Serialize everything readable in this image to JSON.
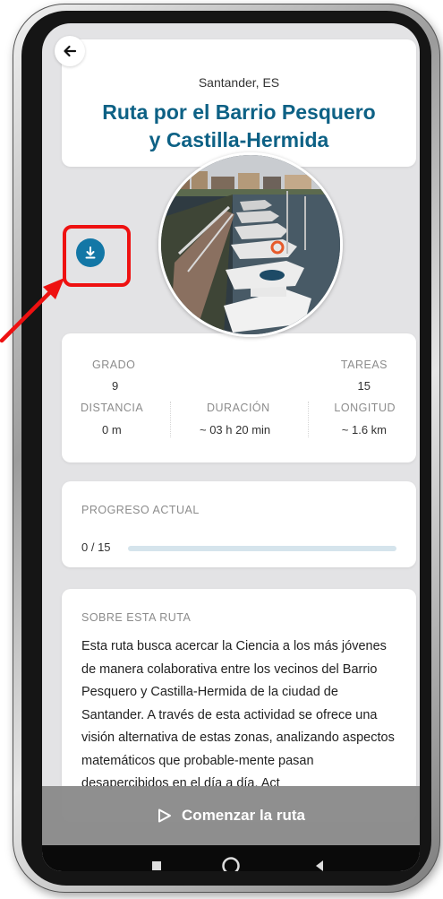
{
  "header": {
    "location": "Santander, ES",
    "title_line1": "Ruta por el Barrio Pesquero",
    "title_line2": "y Castilla-Hermida"
  },
  "stats": {
    "grado_label": "GRADO",
    "grado_value": "9",
    "tareas_label": "TAREAS",
    "tareas_value": "15",
    "distancia_label": "DISTANCIA",
    "distancia_value": "0 m",
    "duracion_label": "DURACIÓN",
    "duracion_value": "~ 03 h 20 min",
    "longitud_label": "LONGITUD",
    "longitud_value": "~ 1.6 km"
  },
  "progress": {
    "label": "PROGRESO ACTUAL",
    "value_text": "0 / 15",
    "fraction": 0
  },
  "about": {
    "label": "SOBRE ESTA RUTA",
    "text": "Esta ruta busca acercar la Ciencia a los más jóvenes de manera colaborativa entre los vecinos del Barrio Pesquero y Castilla-Hermida de la ciudad de Santander. A través de esta actividad se ofrece una visión alternativa de estas zonas, analizando aspectos matemáticos que probable-mente pasan desapercibidos en el día a día. Act"
  },
  "actions": {
    "start_label": "Comenzar la ruta"
  },
  "icons": {
    "back": "arrow-left-icon",
    "download": "download-icon",
    "start": "play-outline-icon",
    "nav_recents": "square-icon",
    "nav_home": "circle-icon",
    "nav_back": "triangle-left-icon"
  },
  "colors": {
    "accent": "#1377a6",
    "title": "#0d6185",
    "highlight": "#ee1111",
    "start_bar": "#8a8a8a"
  }
}
